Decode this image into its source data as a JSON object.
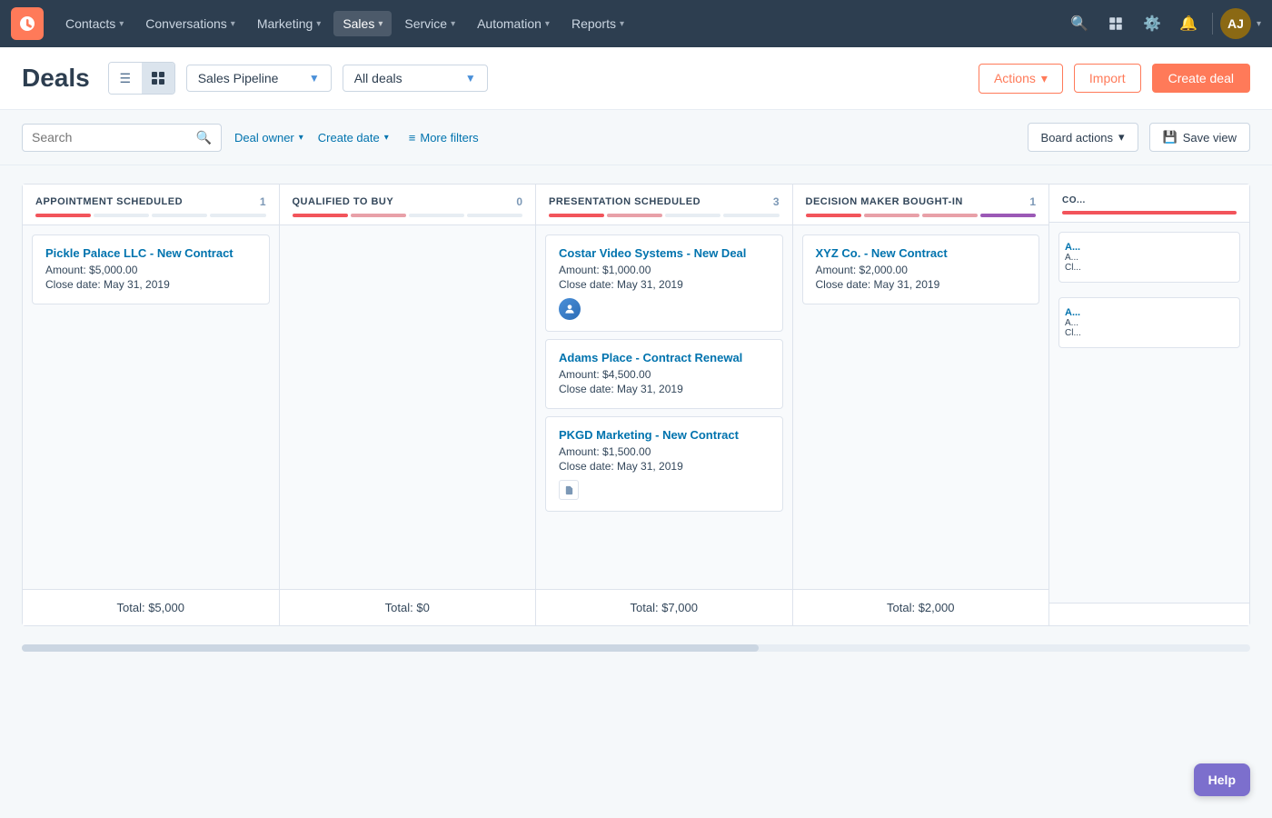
{
  "nav": {
    "logo": "H",
    "items": [
      {
        "label": "Contacts",
        "hasDropdown": true
      },
      {
        "label": "Conversations",
        "hasDropdown": true
      },
      {
        "label": "Marketing",
        "hasDropdown": true
      },
      {
        "label": "Sales",
        "hasDropdown": true,
        "active": true
      },
      {
        "label": "Service",
        "hasDropdown": true
      },
      {
        "label": "Automation",
        "hasDropdown": true
      },
      {
        "label": "Reports",
        "hasDropdown": true
      }
    ],
    "icons": [
      "search",
      "marketplace",
      "settings",
      "notifications"
    ],
    "avatar_initials": "AJ"
  },
  "page": {
    "title": "Deals",
    "view_list_label": "☰",
    "view_grid_label": "⊞",
    "pipeline_label": "Sales Pipeline",
    "filter_label": "All deals",
    "btn_actions": "Actions",
    "btn_import": "Import",
    "btn_create": "Create deal"
  },
  "filters": {
    "search_placeholder": "Search",
    "deal_owner_label": "Deal owner",
    "create_date_label": "Create date",
    "more_filters_label": "More filters",
    "board_actions_label": "Board actions",
    "save_view_label": "Save view"
  },
  "columns": [
    {
      "id": "appointment-scheduled",
      "title": "APPOINTMENT SCHEDULED",
      "count": 1,
      "bars": [
        "red",
        "empty",
        "empty",
        "empty"
      ],
      "deals": [
        {
          "title": "Pickle Palace LLC - New Contract",
          "amount": "Amount: $5,000.00",
          "close_date": "Close date: May 31, 2019",
          "has_avatar": false,
          "has_icon": false
        }
      ],
      "total": "Total: $5,000"
    },
    {
      "id": "qualified-to-buy",
      "title": "QUALIFIED TO BUY",
      "count": 0,
      "bars": [
        "red",
        "pink",
        "empty",
        "empty"
      ],
      "deals": [],
      "total": "Total: $0"
    },
    {
      "id": "presentation-scheduled",
      "title": "PRESENTATION SCHEDULED",
      "count": 3,
      "bars": [
        "red",
        "pink",
        "empty",
        "empty"
      ],
      "deals": [
        {
          "title": "Costar Video Systems - New Deal",
          "amount": "Amount: $1,000.00",
          "close_date": "Close date: May 31, 2019",
          "has_avatar": true,
          "has_icon": false
        },
        {
          "title": "Adams Place - Contract Renewal",
          "amount": "Amount: $4,500.00",
          "close_date": "Close date: May 31, 2019",
          "has_avatar": false,
          "has_icon": false
        },
        {
          "title": "PKGD Marketing - New Contract",
          "amount": "Amount: $1,500.00",
          "close_date": "Close date: May 31, 2019",
          "has_avatar": false,
          "has_icon": true
        }
      ],
      "total": "Total: $7,000"
    },
    {
      "id": "decision-maker-bought-in",
      "title": "DECISION MAKER BOUGHT-IN",
      "count": 1,
      "bars": [
        "red",
        "pink",
        "pink",
        "purple"
      ],
      "deals": [
        {
          "title": "XYZ Co. - New Contract",
          "amount": "Amount: $2,000.00",
          "close_date": "Close date: May 31, 2019",
          "has_avatar": false,
          "has_icon": false
        }
      ],
      "total": "Total: $2,000"
    },
    {
      "id": "contract-sent",
      "title": "CO...",
      "count": "",
      "bars": [
        "red"
      ],
      "deals": [
        {
          "title": "A...",
          "amount": "A...",
          "close_date": "Cl...",
          "has_avatar": false,
          "has_icon": false
        },
        {
          "title": "A...",
          "amount": "A...",
          "close_date": "Cl...",
          "has_avatar": false,
          "has_icon": false
        }
      ],
      "total": ""
    }
  ],
  "help_label": "Help"
}
